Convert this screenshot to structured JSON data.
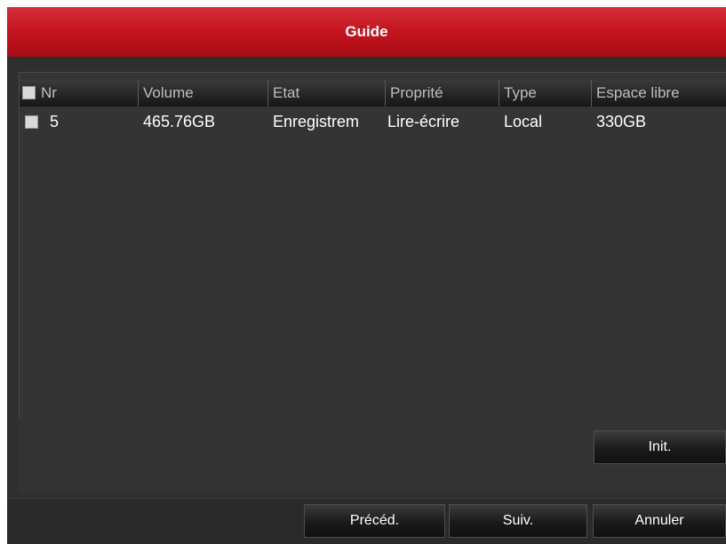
{
  "window": {
    "title": "Guide"
  },
  "table": {
    "columns": [
      "Nr",
      "Volume",
      "Etat",
      "Proprité",
      "Type",
      "Espace libre"
    ],
    "rows": [
      {
        "nr": "5",
        "volume": "465.76GB",
        "etat": "Enregistrem",
        "propriete": "Lire-écrire",
        "type": "Local",
        "espace_libre": "330GB"
      }
    ]
  },
  "buttons": {
    "init": "Init.",
    "previous": "Précéd.",
    "next": "Suiv.",
    "cancel": "Annuler"
  },
  "colors": {
    "title_bar": "#c4141f",
    "background": "#2f2f2f"
  }
}
